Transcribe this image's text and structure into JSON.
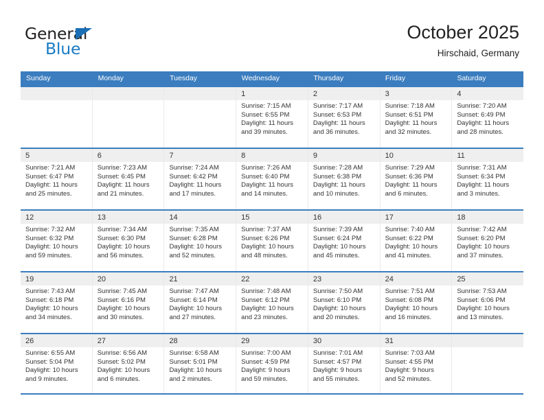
{
  "brand": {
    "name_top": "General",
    "name_bottom": "Blue",
    "triangle_color": "#1a6fb5",
    "text_color": "#231f20",
    "blue_color": "#1a7bc4"
  },
  "header": {
    "title": "October 2025",
    "subtitle": "Hirschaid, Germany"
  },
  "theme": {
    "header_blue": "#3b7dbf",
    "numstrip_gray": "#efefef",
    "cell_white": "#ffffff",
    "text": "#333333"
  },
  "weekday_headers": [
    "Sunday",
    "Monday",
    "Tuesday",
    "Wednesday",
    "Thursday",
    "Friday",
    "Saturday"
  ],
  "weeks": [
    [
      {
        "empty": true
      },
      {
        "empty": true
      },
      {
        "empty": true
      },
      {
        "day": "1",
        "sunrise": "Sunrise: 7:15 AM",
        "sunset": "Sunset: 6:55 PM",
        "daylight1": "Daylight: 11 hours",
        "daylight2": "and 39 minutes."
      },
      {
        "day": "2",
        "sunrise": "Sunrise: 7:17 AM",
        "sunset": "Sunset: 6:53 PM",
        "daylight1": "Daylight: 11 hours",
        "daylight2": "and 36 minutes."
      },
      {
        "day": "3",
        "sunrise": "Sunrise: 7:18 AM",
        "sunset": "Sunset: 6:51 PM",
        "daylight1": "Daylight: 11 hours",
        "daylight2": "and 32 minutes."
      },
      {
        "day": "4",
        "sunrise": "Sunrise: 7:20 AM",
        "sunset": "Sunset: 6:49 PM",
        "daylight1": "Daylight: 11 hours",
        "daylight2": "and 28 minutes."
      }
    ],
    [
      {
        "day": "5",
        "sunrise": "Sunrise: 7:21 AM",
        "sunset": "Sunset: 6:47 PM",
        "daylight1": "Daylight: 11 hours",
        "daylight2": "and 25 minutes."
      },
      {
        "day": "6",
        "sunrise": "Sunrise: 7:23 AM",
        "sunset": "Sunset: 6:45 PM",
        "daylight1": "Daylight: 11 hours",
        "daylight2": "and 21 minutes."
      },
      {
        "day": "7",
        "sunrise": "Sunrise: 7:24 AM",
        "sunset": "Sunset: 6:42 PM",
        "daylight1": "Daylight: 11 hours",
        "daylight2": "and 17 minutes."
      },
      {
        "day": "8",
        "sunrise": "Sunrise: 7:26 AM",
        "sunset": "Sunset: 6:40 PM",
        "daylight1": "Daylight: 11 hours",
        "daylight2": "and 14 minutes."
      },
      {
        "day": "9",
        "sunrise": "Sunrise: 7:28 AM",
        "sunset": "Sunset: 6:38 PM",
        "daylight1": "Daylight: 11 hours",
        "daylight2": "and 10 minutes."
      },
      {
        "day": "10",
        "sunrise": "Sunrise: 7:29 AM",
        "sunset": "Sunset: 6:36 PM",
        "daylight1": "Daylight: 11 hours",
        "daylight2": "and 6 minutes."
      },
      {
        "day": "11",
        "sunrise": "Sunrise: 7:31 AM",
        "sunset": "Sunset: 6:34 PM",
        "daylight1": "Daylight: 11 hours",
        "daylight2": "and 3 minutes."
      }
    ],
    [
      {
        "day": "12",
        "sunrise": "Sunrise: 7:32 AM",
        "sunset": "Sunset: 6:32 PM",
        "daylight1": "Daylight: 10 hours",
        "daylight2": "and 59 minutes."
      },
      {
        "day": "13",
        "sunrise": "Sunrise: 7:34 AM",
        "sunset": "Sunset: 6:30 PM",
        "daylight1": "Daylight: 10 hours",
        "daylight2": "and 56 minutes."
      },
      {
        "day": "14",
        "sunrise": "Sunrise: 7:35 AM",
        "sunset": "Sunset: 6:28 PM",
        "daylight1": "Daylight: 10 hours",
        "daylight2": "and 52 minutes."
      },
      {
        "day": "15",
        "sunrise": "Sunrise: 7:37 AM",
        "sunset": "Sunset: 6:26 PM",
        "daylight1": "Daylight: 10 hours",
        "daylight2": "and 48 minutes."
      },
      {
        "day": "16",
        "sunrise": "Sunrise: 7:39 AM",
        "sunset": "Sunset: 6:24 PM",
        "daylight1": "Daylight: 10 hours",
        "daylight2": "and 45 minutes."
      },
      {
        "day": "17",
        "sunrise": "Sunrise: 7:40 AM",
        "sunset": "Sunset: 6:22 PM",
        "daylight1": "Daylight: 10 hours",
        "daylight2": "and 41 minutes."
      },
      {
        "day": "18",
        "sunrise": "Sunrise: 7:42 AM",
        "sunset": "Sunset: 6:20 PM",
        "daylight1": "Daylight: 10 hours",
        "daylight2": "and 37 minutes."
      }
    ],
    [
      {
        "day": "19",
        "sunrise": "Sunrise: 7:43 AM",
        "sunset": "Sunset: 6:18 PM",
        "daylight1": "Daylight: 10 hours",
        "daylight2": "and 34 minutes."
      },
      {
        "day": "20",
        "sunrise": "Sunrise: 7:45 AM",
        "sunset": "Sunset: 6:16 PM",
        "daylight1": "Daylight: 10 hours",
        "daylight2": "and 30 minutes."
      },
      {
        "day": "21",
        "sunrise": "Sunrise: 7:47 AM",
        "sunset": "Sunset: 6:14 PM",
        "daylight1": "Daylight: 10 hours",
        "daylight2": "and 27 minutes."
      },
      {
        "day": "22",
        "sunrise": "Sunrise: 7:48 AM",
        "sunset": "Sunset: 6:12 PM",
        "daylight1": "Daylight: 10 hours",
        "daylight2": "and 23 minutes."
      },
      {
        "day": "23",
        "sunrise": "Sunrise: 7:50 AM",
        "sunset": "Sunset: 6:10 PM",
        "daylight1": "Daylight: 10 hours",
        "daylight2": "and 20 minutes."
      },
      {
        "day": "24",
        "sunrise": "Sunrise: 7:51 AM",
        "sunset": "Sunset: 6:08 PM",
        "daylight1": "Daylight: 10 hours",
        "daylight2": "and 16 minutes."
      },
      {
        "day": "25",
        "sunrise": "Sunrise: 7:53 AM",
        "sunset": "Sunset: 6:06 PM",
        "daylight1": "Daylight: 10 hours",
        "daylight2": "and 13 minutes."
      }
    ],
    [
      {
        "day": "26",
        "sunrise": "Sunrise: 6:55 AM",
        "sunset": "Sunset: 5:04 PM",
        "daylight1": "Daylight: 10 hours",
        "daylight2": "and 9 minutes."
      },
      {
        "day": "27",
        "sunrise": "Sunrise: 6:56 AM",
        "sunset": "Sunset: 5:02 PM",
        "daylight1": "Daylight: 10 hours",
        "daylight2": "and 6 minutes."
      },
      {
        "day": "28",
        "sunrise": "Sunrise: 6:58 AM",
        "sunset": "Sunset: 5:01 PM",
        "daylight1": "Daylight: 10 hours",
        "daylight2": "and 2 minutes."
      },
      {
        "day": "29",
        "sunrise": "Sunrise: 7:00 AM",
        "sunset": "Sunset: 4:59 PM",
        "daylight1": "Daylight: 9 hours",
        "daylight2": "and 59 minutes."
      },
      {
        "day": "30",
        "sunrise": "Sunrise: 7:01 AM",
        "sunset": "Sunset: 4:57 PM",
        "daylight1": "Daylight: 9 hours",
        "daylight2": "and 55 minutes."
      },
      {
        "day": "31",
        "sunrise": "Sunrise: 7:03 AM",
        "sunset": "Sunset: 4:55 PM",
        "daylight1": "Daylight: 9 hours",
        "daylight2": "and 52 minutes."
      },
      {
        "empty": true
      }
    ]
  ]
}
